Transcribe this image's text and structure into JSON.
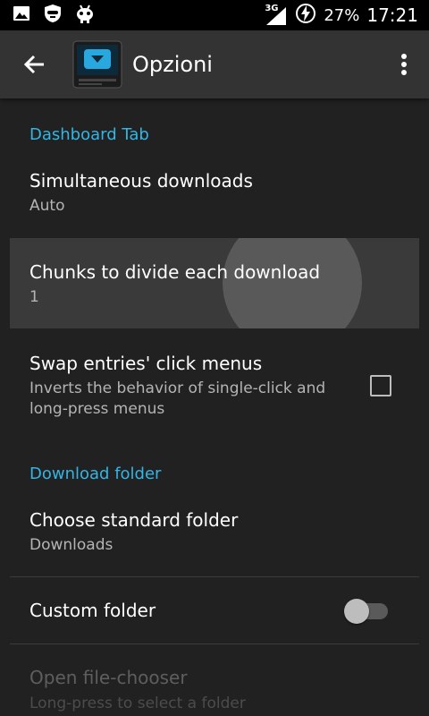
{
  "status_bar": {
    "network": "3G",
    "battery": "27%",
    "time": "17:21",
    "icons": [
      "image-icon",
      "shield-face-icon",
      "android-icon",
      "signal-icon",
      "battery-charging-icon"
    ]
  },
  "app_bar": {
    "title": "Opzioni",
    "icons": [
      "back-arrow-icon",
      "app-download-icon",
      "overflow-menu-icon"
    ]
  },
  "sections": [
    {
      "header": "Dashboard Tab",
      "items": [
        {
          "title": "Simultaneous downloads",
          "summary": "Auto"
        },
        {
          "title": "Chunks to divide each download",
          "summary": "1",
          "pressed": true
        },
        {
          "title": "Swap entries' click menus",
          "summary_lines": [
            "Inverts the behavior of single-click and",
            "long-press menus"
          ],
          "control": "checkbox",
          "checked": false
        }
      ]
    },
    {
      "header": "Download folder",
      "items": [
        {
          "title": "Choose standard folder",
          "summary": "Downloads"
        },
        {
          "title": "Custom folder",
          "control": "switch",
          "on": false
        },
        {
          "title": "Open file-chooser",
          "summary": "Long-press to select a folder",
          "enabled": false
        }
      ]
    }
  ],
  "colors": {
    "accent": "#33b5e5",
    "background": "#212121",
    "app_bar": "#333333",
    "status_bar": "#000000"
  }
}
